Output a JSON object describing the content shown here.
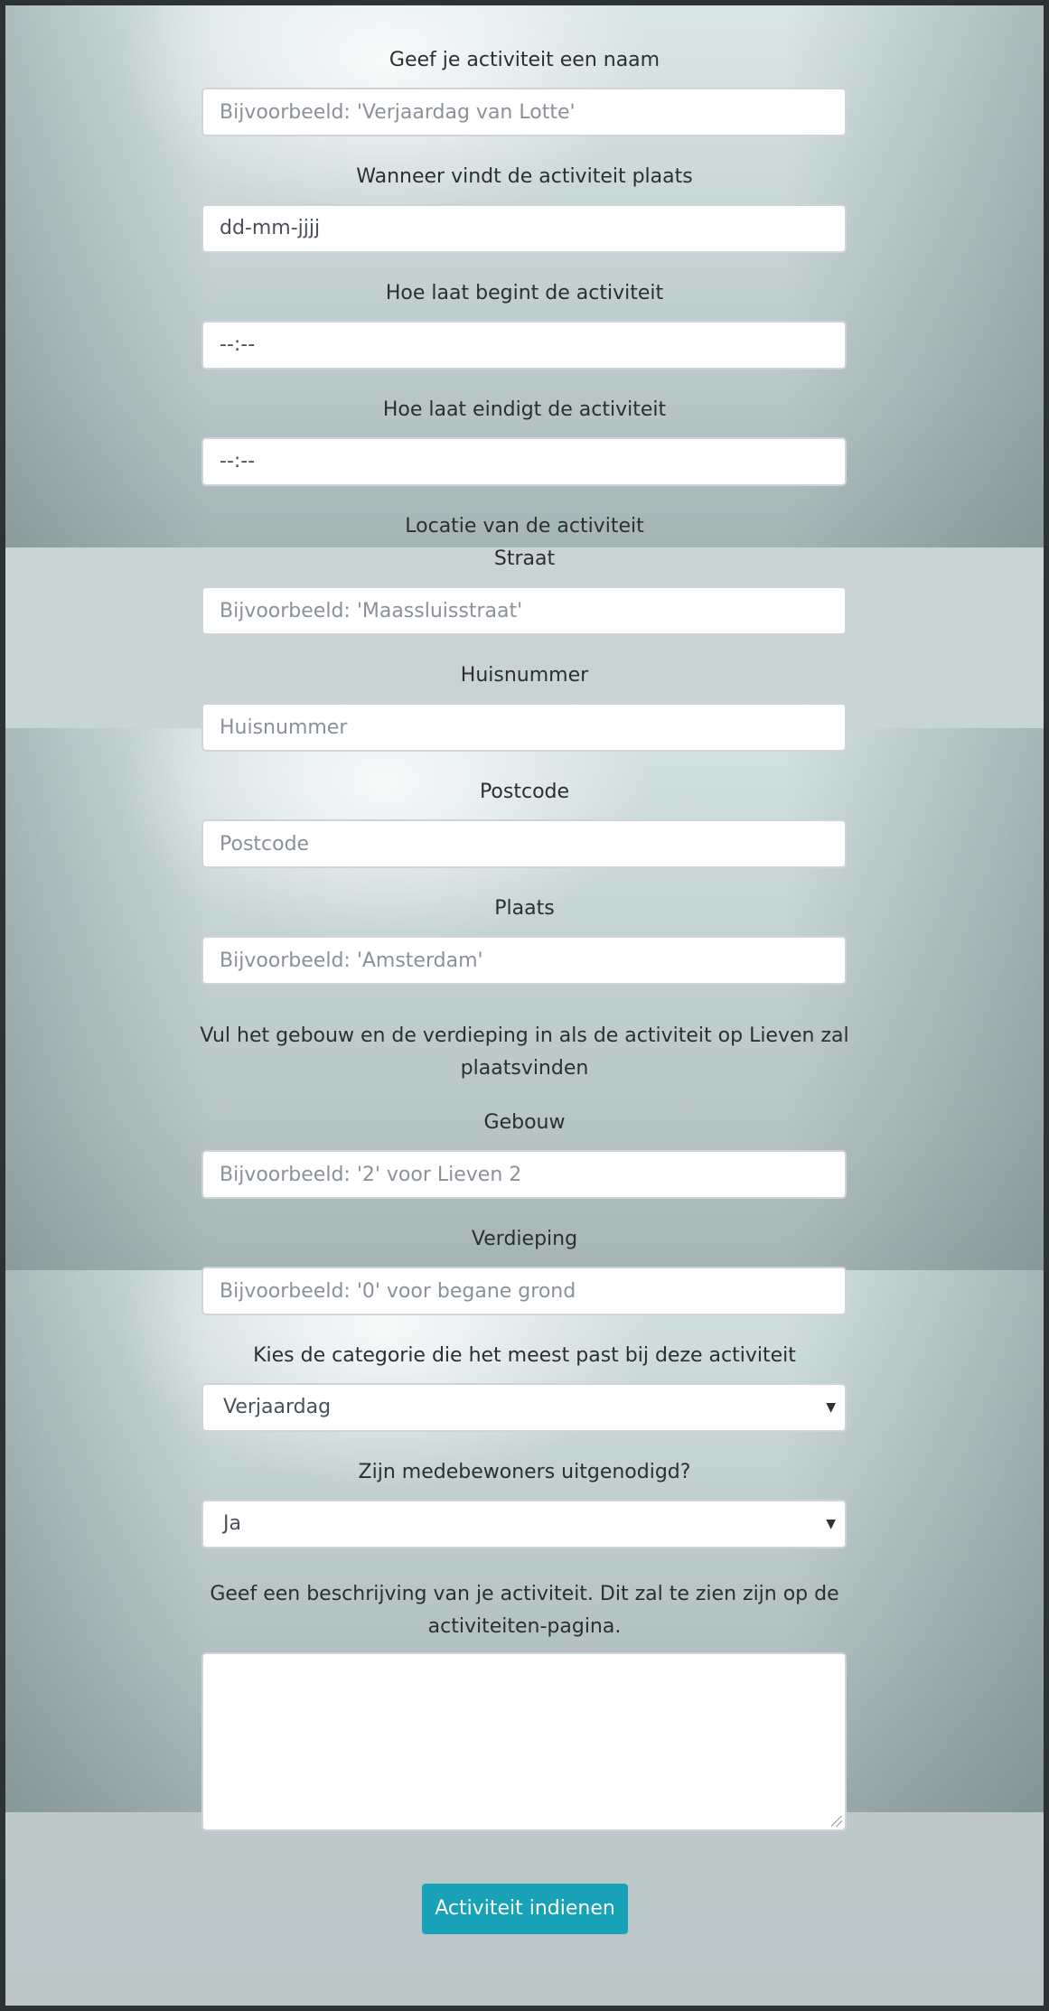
{
  "form": {
    "name_label": "Geef je activiteit een naam",
    "name_placeholder": "Bijvoorbeeld: 'Verjaardag van Lotte'",
    "date_label": "Wanneer vindt de activiteit plaats",
    "date_value": "dd-mm-jjjj",
    "start_label": "Hoe laat begint de activiteit",
    "start_value": "--:--",
    "end_label": "Hoe laat eindigt de activiteit",
    "end_value": "--:--",
    "location_heading": "Locatie van de activiteit",
    "street_label": "Straat",
    "street_placeholder": "Bijvoorbeeld: 'Maassluisstraat'",
    "housenumber_label": "Huisnummer",
    "housenumber_placeholder": "Huisnummer",
    "postcode_label": "Postcode",
    "postcode_placeholder": "Postcode",
    "city_label": "Plaats",
    "city_placeholder": "Bijvoorbeeld: 'Amsterdam'",
    "building_note_line1": "Vul het gebouw en de verdieping in als de activiteit op Lieven zal",
    "building_note_line2": "plaatsvinden",
    "building_label": "Gebouw",
    "building_placeholder": "Bijvoorbeeld: '2' voor Lieven 2",
    "floor_label": "Verdieping",
    "floor_placeholder": "Bijvoorbeeld: '0' voor begane grond",
    "category_label": "Kies de categorie die het meest past bij deze activiteit",
    "category_value": "Verjaardag",
    "invited_label": "Zijn medebewoners uitgenodigd?",
    "invited_value": "Ja",
    "description_label_line1": "Geef een beschrijving van je activiteit. Dit zal te zien zijn op de",
    "description_label_line2": "activiteiten-pagina.",
    "submit_label": "Activiteit indienen"
  },
  "colors": {
    "button": "#17a2b8",
    "input_border": "#ced4da"
  }
}
